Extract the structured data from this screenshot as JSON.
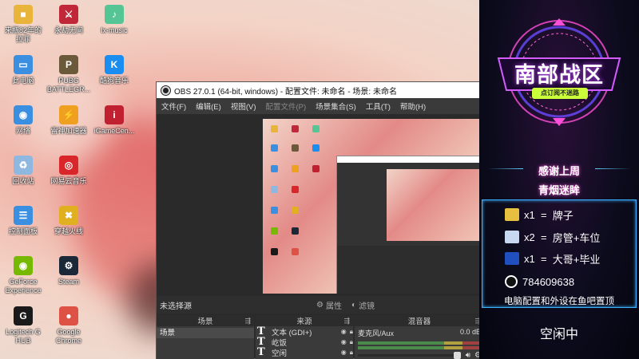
{
  "desktop": {
    "icons": [
      {
        "label": "来瓶82年的\n拉菲",
        "color": "#e8b43a",
        "glyph": "■"
      },
      {
        "label": "永劫无间",
        "color": "#c0283a",
        "glyph": "⚔"
      },
      {
        "label": "lx-music",
        "color": "#56c596",
        "glyph": "♪"
      },
      {
        "label": "此电脑",
        "color": "#3b8fe0",
        "glyph": "▭"
      },
      {
        "label": "PUBG\nBATTLEGR...",
        "color": "#6a5a3a",
        "glyph": "P"
      },
      {
        "label": "酷狗音乐",
        "color": "#1a8ef0",
        "glyph": "K"
      },
      {
        "label": "网络",
        "color": "#3b8fe0",
        "glyph": "◉"
      },
      {
        "label": "雷神加速器",
        "color": "#f0a020",
        "glyph": "⚡"
      },
      {
        "label": "iGameCen...",
        "color": "#c02030",
        "glyph": "i"
      },
      {
        "label": "回收站",
        "color": "#8fb8e0",
        "glyph": "♻"
      },
      {
        "label": "网易云音乐",
        "color": "#d8262b",
        "glyph": "◎"
      },
      {
        "label": "控制面板",
        "color": "#3b8fe0",
        "glyph": "☰"
      },
      {
        "label": "穿越火线",
        "color": "#e0b020",
        "glyph": "✖"
      },
      {
        "label": "GeForce\nExperience",
        "color": "#76b900",
        "glyph": "◉"
      },
      {
        "label": "Steam",
        "color": "#1b2838",
        "glyph": "⚙"
      },
      {
        "label": "Logitech G\nHUB",
        "color": "#1a1a1a",
        "glyph": "G"
      },
      {
        "label": "Google\nChrome",
        "color": "#de5246",
        "glyph": "●"
      }
    ]
  },
  "obs": {
    "title": "OBS 27.0.1 (64-bit, windows) - 配置文件: 未命名 - 场景: 未命名",
    "menu": [
      "文件(F)",
      "编辑(E)",
      "视图(V)",
      "配置文件(P)",
      "场景集合(S)",
      "工具(T)",
      "帮助(H)"
    ],
    "no_source": "未选择源",
    "properties": "属性",
    "filters": "滤镜",
    "docks": {
      "scenes": "场景",
      "sources": "来源",
      "mixer": "混音器"
    },
    "scene_items": [
      "场景"
    ],
    "sources": [
      "文本 (GDI+)",
      "屹饭",
      "空闲"
    ],
    "mixer": {
      "channel": "麦克风/Aux",
      "db": "0.0 dB"
    }
  },
  "panel": {
    "zone_title": "南部战区",
    "zone_sub": "点订阅不迷路",
    "thanks_line1": "感谢上周",
    "thanks_line2": "青烟迷眸",
    "gifts": [
      {
        "qty": "x1",
        "eq": "=",
        "name": "牌子",
        "color": "#e8c040"
      },
      {
        "qty": "x2",
        "eq": "=",
        "name": "房管+车位",
        "color": "#c8d8f0"
      },
      {
        "qty": "x1",
        "eq": "=",
        "name": "大哥+毕业",
        "color": "#2050c0"
      }
    ],
    "qq": "784609638",
    "notice": "电脑配置和外设在鱼吧置顶",
    "status": "空闲中"
  }
}
